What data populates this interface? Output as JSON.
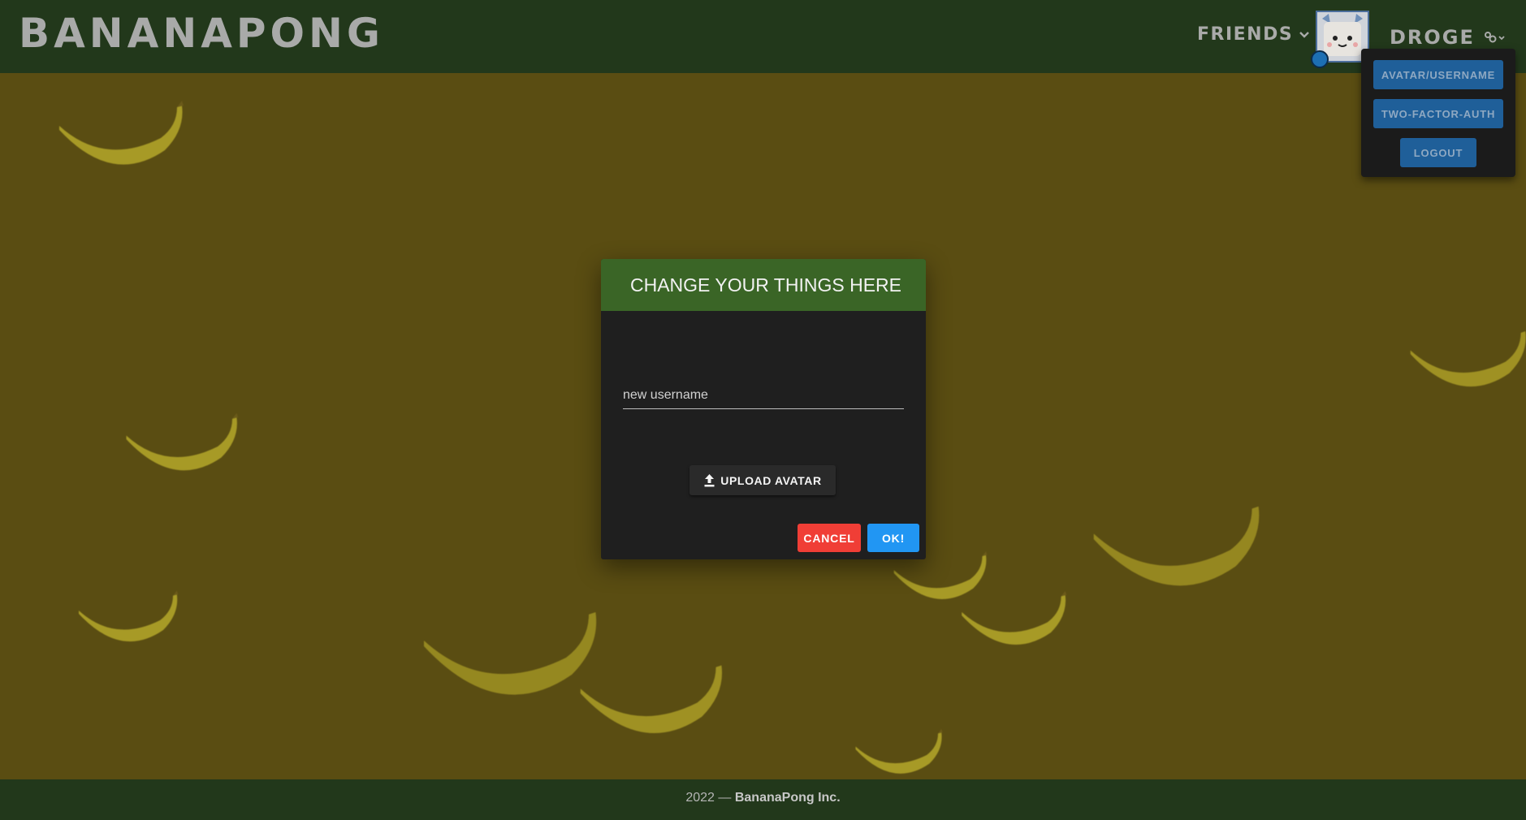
{
  "header": {
    "logo": "BANANAPONG",
    "friends_label": "FRIENDS",
    "username": "DROGE"
  },
  "user_menu": {
    "items": [
      {
        "label": "AVATAR/USERNAME"
      },
      {
        "label": "TWO-FACTOR-AUTH"
      },
      {
        "label": "LOGOUT"
      }
    ]
  },
  "dialog": {
    "title": "CHANGE YOUR THINGS HERE",
    "username_field": {
      "label": "new username",
      "value": ""
    },
    "upload_label": "UPLOAD AVATAR",
    "cancel_label": "CANCEL",
    "ok_label": "OK!"
  },
  "footer": {
    "year_prefix": "2022 —",
    "company": "BananaPong Inc."
  },
  "colors": {
    "background": "#5a4d12",
    "header": "#22381b",
    "dialog_header": "#3a6526",
    "dialog_body": "#1f1f1f",
    "cancel": "#f03e36",
    "ok": "#2196f3",
    "menu_button": "#1f5f99"
  },
  "icons": {
    "friends_chevron": "chevron-down-icon",
    "settings": "gear-icon",
    "upload": "upload-icon"
  }
}
